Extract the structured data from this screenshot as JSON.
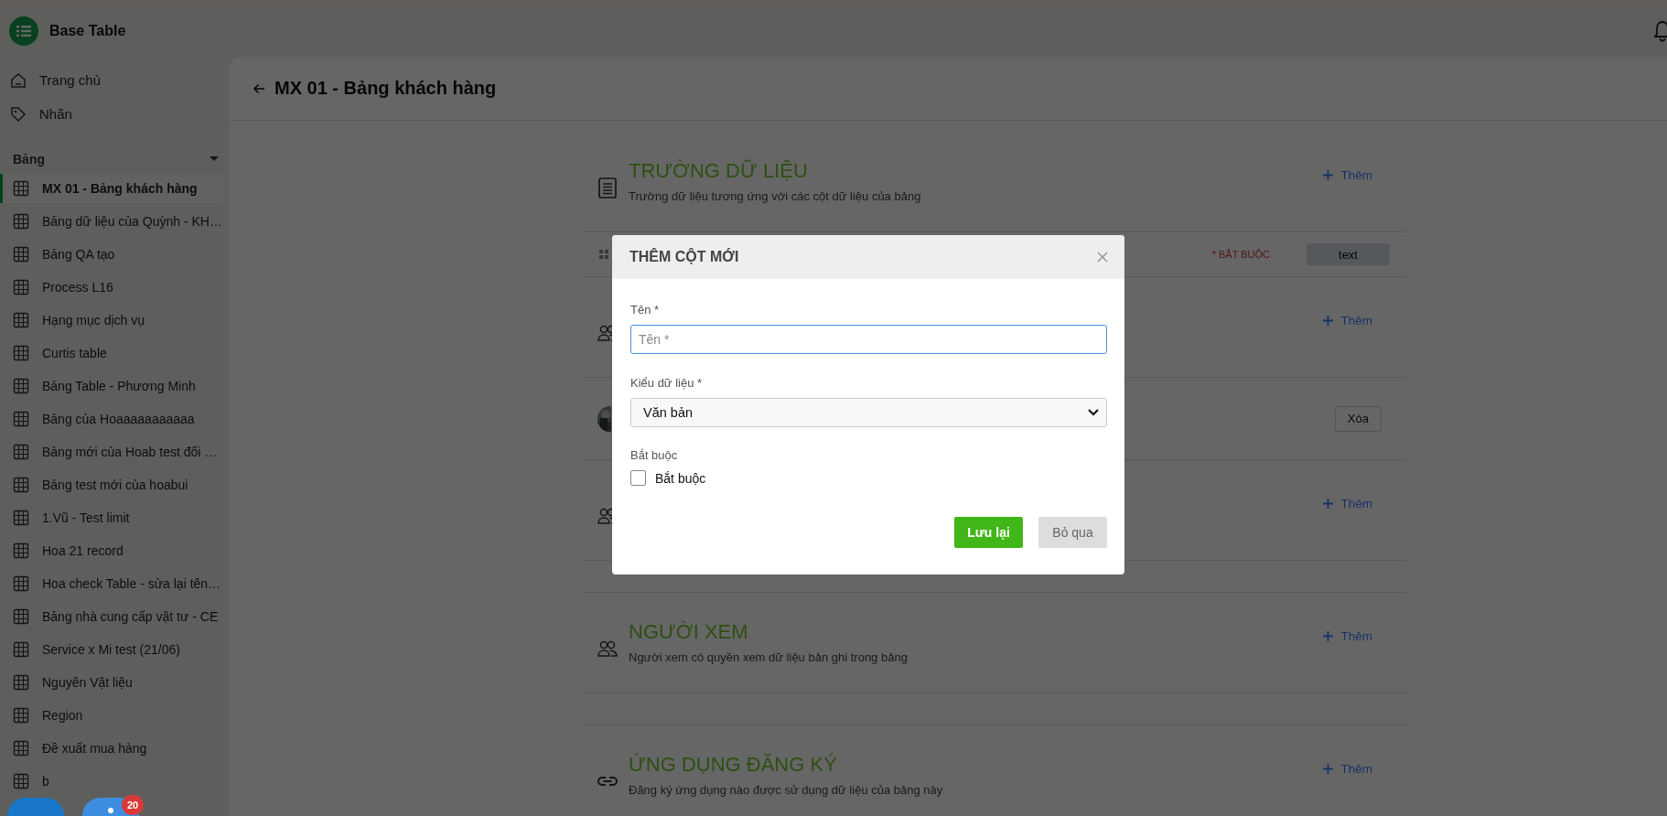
{
  "app": {
    "title": "Base Table"
  },
  "nav": [
    {
      "kind": "home",
      "label": "Trang chủ"
    },
    {
      "kind": "tag",
      "label": "Nhãn"
    }
  ],
  "tables_section": {
    "label": "Bảng",
    "expanded": true
  },
  "tables": [
    {
      "label": "MX 01 - Bảng khách hàng",
      "selected": true
    },
    {
      "label": "Bảng dữ liệu của Quỳnh - KH…",
      "selected": false
    },
    {
      "label": "Bảng QA tạo",
      "selected": false
    },
    {
      "label": "Process L16",
      "selected": false
    },
    {
      "label": "Hạng mục dịch vụ",
      "selected": false
    },
    {
      "label": "Curtis table",
      "selected": false
    },
    {
      "label": "Bảng Table - Phương Minh",
      "selected": false
    },
    {
      "label": "Bảng của Hoaaaaaaaaaaa",
      "selected": false
    },
    {
      "label": "Bảng mới của Hoab test đổi …",
      "selected": false
    },
    {
      "label": "Bảng test mới của hoabui",
      "selected": false
    },
    {
      "label": "1.Vũ - Test limit",
      "selected": false
    },
    {
      "label": "Hoa 21 record",
      "selected": false
    },
    {
      "label": "Hoa check Table - sửa lại tên…",
      "selected": false
    },
    {
      "label": "Bảng nhà cung cấp vật tư - CE",
      "selected": false
    },
    {
      "label": "Service x Mi test (21/06)",
      "selected": false
    },
    {
      "label": "Nguyên Vật liệu",
      "selected": false
    },
    {
      "label": "Region",
      "selected": false
    },
    {
      "label": "Đề xuất mua hàng",
      "selected": false
    },
    {
      "label": "b",
      "selected": false
    }
  ],
  "floating": {
    "badge": "20"
  },
  "page": {
    "title": "MX 01 - Bảng khách hàng"
  },
  "sections": [
    {
      "kind": "fields",
      "title": "TRƯỜNG DỮ LIỆU",
      "description": "Trường dữ liệu tương ứng với các cột dữ liệu của bảng",
      "add": "Thêm",
      "rows": [
        {
          "kind": "field",
          "required": "* BẮT BUỘC",
          "type": "text"
        }
      ]
    },
    {
      "kind": "members",
      "add": "Thêm",
      "rows": [
        {
          "kind": "member",
          "action": "Xóa"
        }
      ]
    },
    {
      "kind": "members",
      "add": "Thêm"
    },
    {
      "kind": "members",
      "title": "NGƯỜI XEM",
      "description": "Người xem có quyền xem dữ liệu bản ghi trong bảng",
      "add": "Thêm"
    },
    {
      "kind": "apps",
      "title": "ỨNG DỤNG ĐĂNG KÝ",
      "description": "Đăng ký ứng dụng nào được sử dụng dữ liệu của bảng này",
      "add": "Thêm"
    }
  ],
  "dialog": {
    "title": "THÊM CỘT MỚI",
    "name_label": "Tên *",
    "name_placeholder": "Tên *",
    "type_label": "Kiểu dữ liệu *",
    "type_value": "Văn bản",
    "required_label": "Bắt buộc",
    "required_checkbox": {
      "label": "Bắt buộc",
      "checked": false
    },
    "buttons": [
      {
        "kind": "primary",
        "label": "Lưu lại"
      },
      {
        "kind": "secondary",
        "label": "Bỏ qua"
      }
    ]
  }
}
